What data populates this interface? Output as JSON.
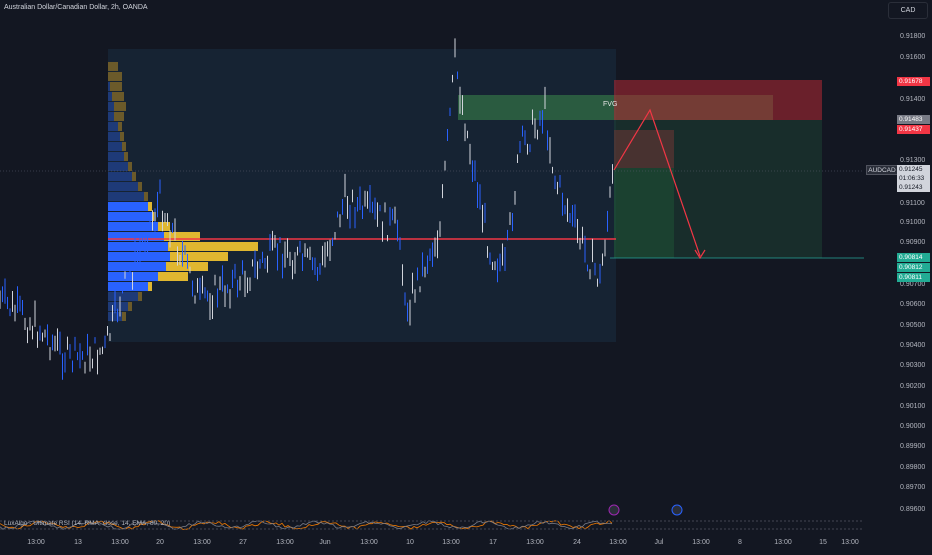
{
  "header": {
    "title": "Australian Dollar/Canadian Dollar, 2h, OANDA"
  },
  "price_axis": {
    "currency": "CAD",
    "ticks": [
      "0.91800",
      "0.91600",
      "0.91400",
      "0.91300",
      "0.91100",
      "0.91000",
      "0.90900",
      "0.90700",
      "0.90600",
      "0.90500",
      "0.90400",
      "0.90300",
      "0.90200",
      "0.90100",
      "0.90000",
      "0.89900",
      "0.89800",
      "0.89700",
      "0.89600"
    ],
    "tags": {
      "target_high": "0.91678",
      "fvg_top": "0.91483",
      "fvg_bottom": "0.91437",
      "symbol": "AUDCAD",
      "last_price": "0.91245",
      "countdown": "01:06:33",
      "prev_price": "0.91243",
      "tp1": "0.90814",
      "tp2": "0.90812",
      "tp3": "0.90811"
    }
  },
  "time_axis": {
    "labels": [
      "13:00",
      "13",
      "13:00",
      "20",
      "13:00",
      "27",
      "13:00",
      "Jun",
      "13:00",
      "10",
      "13:00",
      "17",
      "13:00",
      "24",
      "13:00",
      "Jul",
      "13:00",
      "8",
      "13:00",
      "15",
      "13:00"
    ]
  },
  "annotations": {
    "fvg_label": "FVG"
  },
  "indicator": {
    "label": "LuxAlgo - Ultimate RSI (14, RMA, close, 14, EMA, 80, 20)"
  },
  "colors": {
    "background": "#131722",
    "bull_volume": "#2962ff",
    "bear_volume": "#e0b730",
    "poc_line": "#f23645",
    "fvg_zone": "#3c8a4a",
    "target_zone": "#b22833",
    "tp_zone": "#1e5a38"
  }
}
